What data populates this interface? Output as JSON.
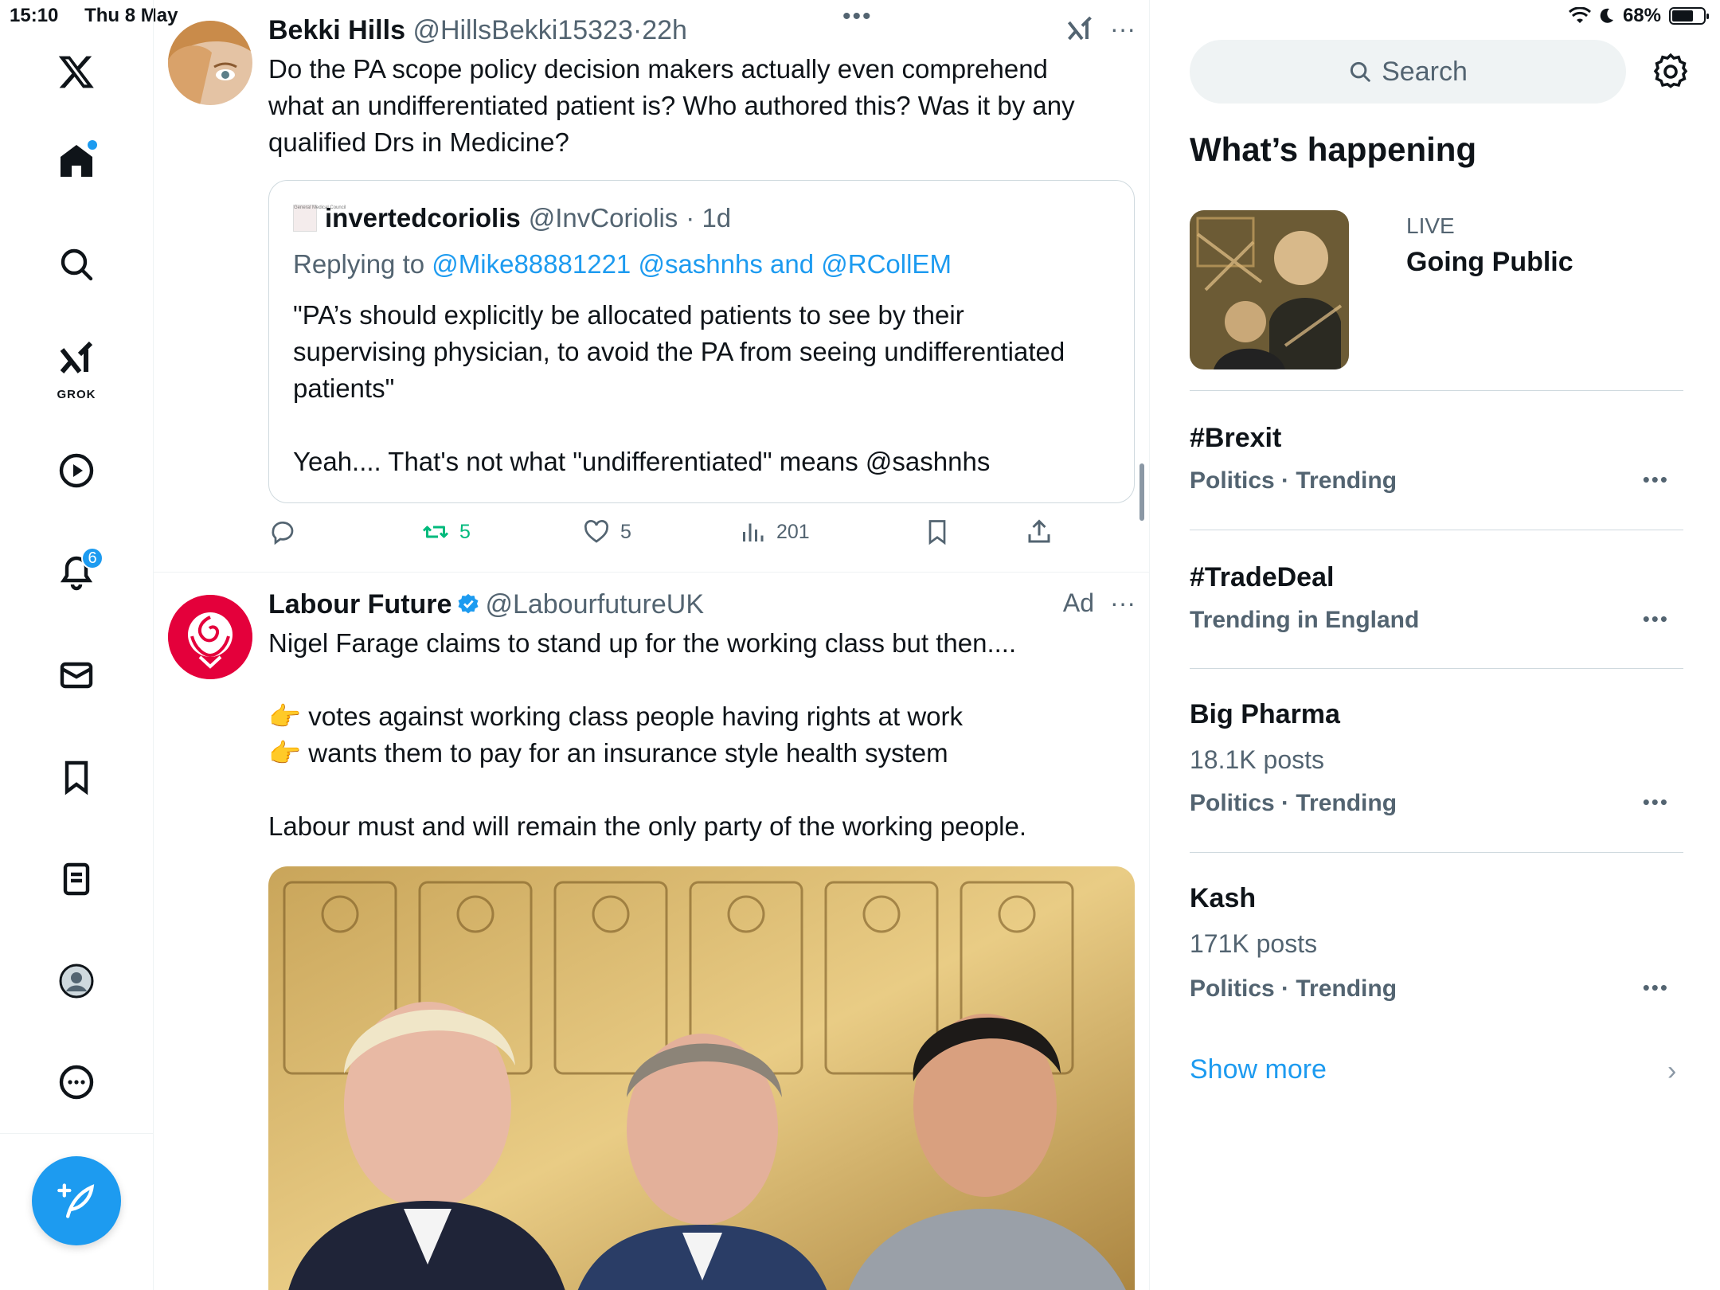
{
  "status_bar": {
    "time": "15:10",
    "date": "Thu 8 May",
    "battery": "68%"
  },
  "nav": {
    "notifications_badge": "6",
    "grok_label": "GROK"
  },
  "timeline": {
    "tweet1": {
      "name": "Bekki Hills",
      "handle": "@HillsBekki15323",
      "separator": "·",
      "time": "22h",
      "text_lines": [
        "Do the PA scope policy decision makers actually even comprehend",
        "what an undifferentiated patient is? Who authored this? Was it by any",
        "qualified Drs in Medicine?"
      ],
      "quote": {
        "logo_text": "General Medical Council",
        "name": "invertedcoriolis",
        "handle": "@InvCoriolis",
        "time": "· 1d",
        "replying_prefix": "Replying to",
        "replying_to": "@Mike88881221 @sashnhs and @RCollEM",
        "text_lines": [
          "\"PA’s should explicitly be allocated patients to see by their",
          "supervising physician, to avoid the PA from seeing undifferentiated",
          "patients\"",
          "",
          "Yeah.... That's not what \"undifferentiated\" means @sashnhs"
        ]
      },
      "actions": {
        "retweets": "5",
        "likes": "5",
        "views": "201"
      }
    },
    "tweet2": {
      "name": "Labour Future",
      "handle": "@LabourfutureUK",
      "ad_label": "Ad",
      "text_lines": [
        "Nigel Farage claims to stand up for the working class but then....",
        "",
        "👉 votes against working class people having rights at work",
        "👉 wants them to pay for an insurance style health system",
        "",
        "Labour must and will remain the only party of the working people."
      ]
    }
  },
  "right": {
    "search_placeholder": "Search",
    "section_title": "What’s happening",
    "live": {
      "tag": "LIVE",
      "title": "Going Public"
    },
    "trends": [
      {
        "title": "#Brexit",
        "posts": "",
        "meta": "Politics · Trending"
      },
      {
        "title": "#TradeDeal",
        "posts": "",
        "meta": "Trending in England"
      },
      {
        "title": "Big Pharma",
        "posts": "18.1K posts",
        "meta": "Politics · Trending"
      },
      {
        "title": "Kash",
        "posts": "171K posts",
        "meta": "Politics · Trending"
      }
    ],
    "show_more": "Show more"
  },
  "colors": {
    "accent": "#1d9bf0",
    "retweet_green": "#00ba7c",
    "secondary_text": "#536471"
  },
  "icons": [
    "x-logo-icon",
    "home-icon",
    "explore-icon",
    "grok-icon",
    "video-icon",
    "notifications-icon",
    "messages-icon",
    "bookmarks-icon",
    "lists-icon",
    "profile-icon",
    "more-icon",
    "compose-icon",
    "search-icon",
    "settings-icon",
    "reply-icon",
    "retweet-icon",
    "like-icon",
    "views-icon",
    "bookmark-icon",
    "share-icon",
    "verified-icon",
    "chevron-right-icon"
  ]
}
